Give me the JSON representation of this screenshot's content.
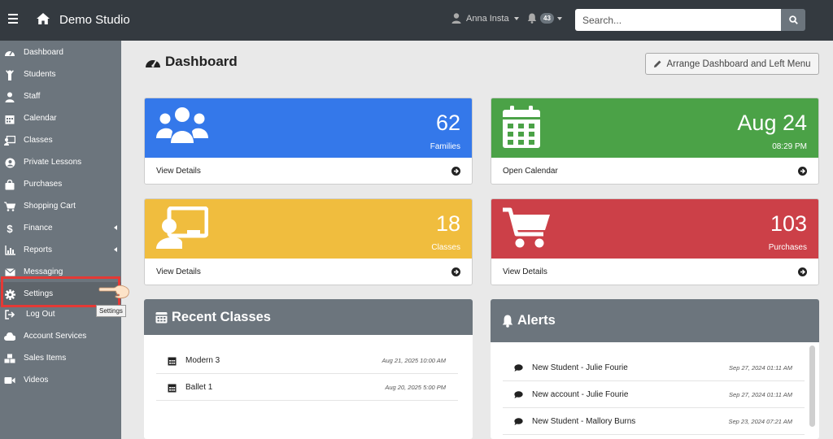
{
  "app": {
    "brand": "Demo Studio"
  },
  "topbar": {
    "user_name": "Anna Insta",
    "notifications_count": "43",
    "search_placeholder": "Search..."
  },
  "sidebar": {
    "items": [
      {
        "label": "Dashboard",
        "icon": "tachometer-icon"
      },
      {
        "label": "Students",
        "icon": "student-icon"
      },
      {
        "label": "Staff",
        "icon": "staff-icon"
      },
      {
        "label": "Calendar",
        "icon": "calendar-icon"
      },
      {
        "label": "Classes",
        "icon": "chalkboard-icon"
      },
      {
        "label": "Private Lessons",
        "icon": "user-circle-icon"
      },
      {
        "label": "Purchases",
        "icon": "shopping-bag-icon"
      },
      {
        "label": "Shopping Cart",
        "icon": "cart-icon"
      },
      {
        "label": "Finance",
        "icon": "dollar-icon"
      },
      {
        "label": "Reports",
        "icon": "chart-icon"
      },
      {
        "label": "Messaging",
        "icon": "envelope-icon"
      },
      {
        "label": "Settings",
        "icon": "gear-icon"
      },
      {
        "label": "Log Out",
        "icon": "sign-out-icon"
      },
      {
        "label": "Account Services",
        "icon": "cloud-icon"
      },
      {
        "label": "Sales Items",
        "icon": "cubes-icon"
      },
      {
        "label": "Videos",
        "icon": "video-icon"
      }
    ],
    "tooltip": "Settings"
  },
  "main": {
    "title": "Dashboard",
    "arrange_button": "Arrange Dashboard and Left Menu",
    "cards": [
      {
        "value": "62",
        "sub": "Families",
        "link": "View Details",
        "color": "#3478ea",
        "icon": "users-icon"
      },
      {
        "value": "Aug 24",
        "sub": "08:29 PM",
        "link": "Open Calendar",
        "color": "#4ba247",
        "icon": "calendar-icon"
      },
      {
        "value": "18",
        "sub": "Classes",
        "link": "View Details",
        "color": "#f0bd3e",
        "icon": "chalkboard-teacher-icon"
      },
      {
        "value": "103",
        "sub": "Purchases",
        "link": "View Details",
        "color": "#cc4048",
        "icon": "cart-icon"
      }
    ],
    "recent_classes": {
      "title": "Recent Classes",
      "rows": [
        {
          "name": "Modern 3",
          "time": "Aug 21, 2025 10:00 AM"
        },
        {
          "name": "Ballet 1",
          "time": "Aug 20, 2025 5:00 PM"
        }
      ]
    },
    "alerts": {
      "title": "Alerts",
      "rows": [
        {
          "text": "New Student - Julie Fourie",
          "time": "Sep 27, 2024 01:11 AM"
        },
        {
          "text": "New account - Julie Fourie",
          "time": "Sep 27, 2024 01:11 AM"
        },
        {
          "text": "New Student - Mallory Burns",
          "time": "Sep 23, 2024 07:21 AM"
        }
      ]
    }
  }
}
